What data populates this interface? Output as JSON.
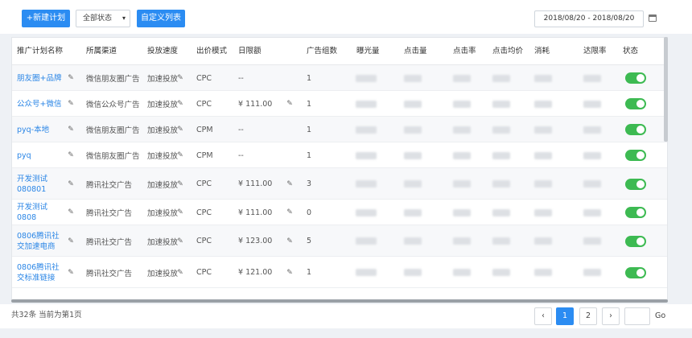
{
  "toolbar": {
    "new_plan_label": "+新建计划",
    "status_select": "全部状态",
    "custom_columns_label": "自定义列表",
    "date_range": "2018/08/20 - 2018/08/20"
  },
  "table": {
    "columns": [
      "推广计划名称",
      "所属渠道",
      "投放速度",
      "出价模式",
      "日限额",
      "广告组数",
      "曝光量",
      "点击量",
      "点击率",
      "点击均价",
      "消耗",
      "达限率",
      "状态"
    ],
    "rows": [
      {
        "name": "朋友圈+品牌",
        "channel": "微信朋友圈广告",
        "speed": "加速投放",
        "bid": "CPC",
        "budget": "--",
        "groups": "1",
        "status_on": true
      },
      {
        "name": "公众号+微信",
        "channel": "微信公众号广告",
        "speed": "加速投放",
        "bid": "CPC",
        "budget": "¥ 111.00",
        "groups": "1",
        "status_on": true
      },
      {
        "name": "pyq-本地",
        "channel": "微信朋友圈广告",
        "speed": "加速投放",
        "bid": "CPM",
        "budget": "--",
        "groups": "1",
        "status_on": true
      },
      {
        "name": "pyq",
        "channel": "微信朋友圈广告",
        "speed": "加速投放",
        "bid": "CPM",
        "budget": "--",
        "groups": "1",
        "status_on": true
      },
      {
        "name": "开发测试080801",
        "channel": "腾讯社交广告",
        "speed": "加速投放",
        "bid": "CPC",
        "budget": "¥ 111.00",
        "groups": "3",
        "status_on": true
      },
      {
        "name": "开发测试0808",
        "channel": "腾讯社交广告",
        "speed": "加速投放",
        "bid": "CPC",
        "budget": "¥ 111.00",
        "groups": "0",
        "status_on": true
      },
      {
        "name": "0806腾讯社交加速电商",
        "channel": "腾讯社交广告",
        "speed": "加速投放",
        "bid": "CPC",
        "budget": "¥ 123.00",
        "groups": "5",
        "status_on": true
      },
      {
        "name": "0806腾讯社交标准链接",
        "channel": "腾讯社交广告",
        "speed": "加速投放",
        "bid": "CPC",
        "budget": "¥ 121.00",
        "groups": "1",
        "status_on": true
      }
    ]
  },
  "pagination": {
    "summary": "共32条 当前为第1页",
    "prev": "‹",
    "next": "›",
    "pages": [
      "1",
      "2"
    ],
    "go_label": "Go"
  },
  "colors": {
    "accent": "#2b8cf2",
    "link": "#2b86e6",
    "toggle_on": "#3dba52"
  }
}
